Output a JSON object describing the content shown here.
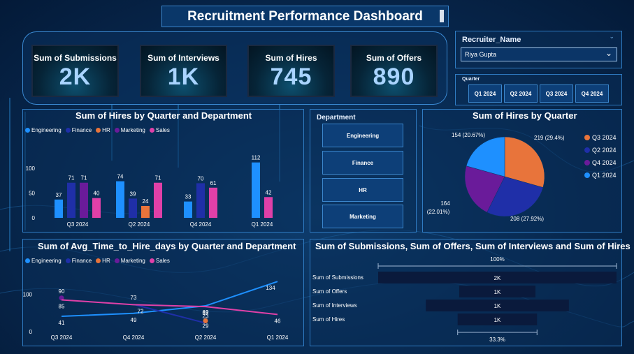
{
  "title": "Recruitment Performance Dashboard",
  "kpis": [
    {
      "label": "Sum of Submissions",
      "value": "2K"
    },
    {
      "label": "Sum of Interviews",
      "value": "1K"
    },
    {
      "label": "Sum of Hires",
      "value": "745"
    },
    {
      "label": "Sum of Offers",
      "value": "890"
    }
  ],
  "recruiter_slicer": {
    "label": "Recruiter_Name",
    "selected": "Riya Gupta"
  },
  "quarter_slicer": {
    "label": "Quarter",
    "options": [
      "Q1 2024",
      "Q2 2024",
      "Q3 2024",
      "Q4 2024"
    ]
  },
  "department_slicer": {
    "label": "Department",
    "options": [
      "Engineering",
      "Finance",
      "HR",
      "Marketing"
    ]
  },
  "colors": {
    "Engineering": "#1e90ff",
    "Finance": "#1f2fa8",
    "HR": "#e8743b",
    "Marketing": "#6a1b9a",
    "Sales": "#e040a8"
  },
  "chart_data": [
    {
      "type": "bar",
      "title": "Sum of Hires by Quarter and Department",
      "categories": [
        "Q3 2024",
        "Q2 2024",
        "Q4 2024",
        "Q1 2024"
      ],
      "series": [
        {
          "name": "Engineering",
          "values": [
            37,
            74,
            33,
            112
          ]
        },
        {
          "name": "Finance",
          "values": [
            71,
            39,
            70,
            null
          ]
        },
        {
          "name": "HR",
          "values": [
            null,
            24,
            null,
            null
          ]
        },
        {
          "name": "Marketing",
          "values": [
            71,
            null,
            null,
            null
          ]
        },
        {
          "name": "Sales",
          "values": [
            40,
            71,
            61,
            42
          ]
        }
      ],
      "yticks": [
        "0",
        "50",
        "100"
      ],
      "ylim": [
        0,
        120
      ],
      "legend": "top-left"
    },
    {
      "type": "pie",
      "title": "Sum of Hires by Quarter",
      "slices": [
        {
          "name": "Q3 2024",
          "value": 219,
          "label": "219 (29.4%)",
          "color": "#e8743b"
        },
        {
          "name": "Q2 2024",
          "value": 208,
          "label": "208 (27.92%)",
          "color": "#1f2fa8"
        },
        {
          "name": "Q4 2024",
          "value": 164,
          "label": "164 (22.01%)",
          "color": "#6a1b9a"
        },
        {
          "name": "Q1 2024",
          "value": 154,
          "label": "154 (20.67%)",
          "color": "#1e90ff"
        }
      ],
      "legend": "right"
    },
    {
      "type": "line",
      "title": "Sum of Avg_Time_to_Hire_days by Quarter and Department",
      "categories": [
        "Q3 2024",
        "Q4 2024",
        "Q2 2024",
        "Q1 2024"
      ],
      "series": [
        {
          "name": "Engineering",
          "values": [
            41,
            49,
            69,
            134
          ]
        },
        {
          "name": "Finance",
          "values": [
            null,
            73,
            23,
            null
          ]
        },
        {
          "name": "HR",
          "values": [
            null,
            null,
            29,
            null
          ]
        },
        {
          "name": "Marketing",
          "values": [
            90,
            null,
            null,
            null
          ]
        },
        {
          "name": "Sales",
          "values": [
            85,
            72,
            67,
            46
          ]
        }
      ],
      "yticks": [
        "0",
        "100"
      ],
      "ylim": [
        0,
        140
      ],
      "legend": "top-left"
    },
    {
      "type": "funnel",
      "title": "Sum of Submissions, Sum of Offers, Sum of Interviews and Sum of Hires",
      "stages": [
        {
          "name": "Sum of Submissions",
          "label": "2K",
          "fraction": 1.0
        },
        {
          "name": "Sum of Offers",
          "label": "1K",
          "fraction": 0.32
        },
        {
          "name": "Sum of Interviews",
          "label": "1K",
          "fraction": 0.6
        },
        {
          "name": "Sum of Hires",
          "label": "1K",
          "fraction": 0.333
        }
      ],
      "top_pct": "100%",
      "bottom_pct": "33.3%"
    }
  ]
}
